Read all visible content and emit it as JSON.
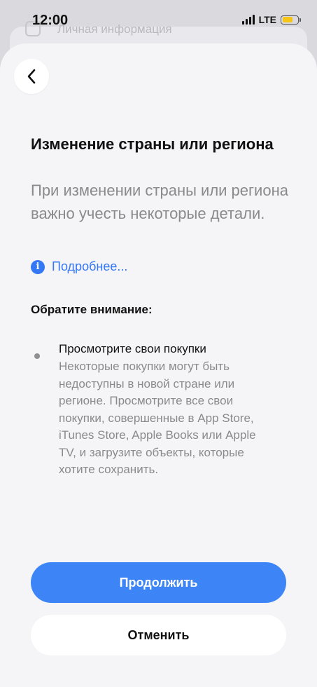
{
  "status_bar": {
    "time": "12:00",
    "network": "LTE",
    "battery_icon": "battery-icon",
    "battery_color": "#f5c518"
  },
  "background_sheet": {
    "title": "Личная информация"
  },
  "nav": {
    "back_icon": "chevron-left-icon"
  },
  "header": {
    "title": "Изменение страны или региона",
    "subtitle": "При изменении страны или региона важно учесть некоторые детали."
  },
  "more_link": {
    "icon": "info-icon",
    "icon_glyph": "i",
    "label": "Подробнее..."
  },
  "notice": {
    "heading": "Обратите внимание:",
    "items": [
      {
        "title": "Просмотрите свои покупки",
        "description": "Некоторые покупки могут быть недоступны в новой стране или регионе. Просмотрите все свои покупки, совершенные в App Store, iTunes Store, Apple Books или Apple TV, и загрузите объекты, которые хотите сохранить."
      }
    ]
  },
  "actions": {
    "continue_label": "Продолжить",
    "cancel_label": "Отменить"
  },
  "colors": {
    "accent": "#3478f6",
    "primary_button": "#3d85f6",
    "secondary_text": "#8a8a8e",
    "sheet_background": "#f5f5f7"
  }
}
